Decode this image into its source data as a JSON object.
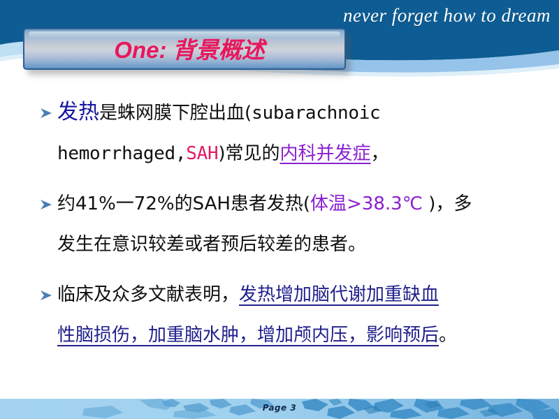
{
  "slide": {
    "tagline": "never forget   how to dream",
    "title_lead": "One:",
    "title_cjk": "背景概述",
    "bullet_marker_icon": "arrowhead-bullet-icon"
  },
  "bullets": [
    {
      "id": "bullet-fever-definition",
      "segments": [
        {
          "text": "发热",
          "style": "blue-large-cjk"
        },
        {
          "text": "是蛛网膜下腔出血(",
          "style": "black-cjk"
        },
        {
          "text": "subarachnoic",
          "style": "black-mono"
        },
        {
          "text": "hemorrhaged,",
          "style": "black-mono"
        },
        {
          "text": "SAH",
          "style": "crimson-mono"
        },
        {
          "text": ")常见的",
          "style": "black-cjk"
        },
        {
          "text": "内科并发症",
          "style": "purple-underline-cjk"
        },
        {
          "text": "，",
          "style": "black-cjk"
        }
      ]
    },
    {
      "id": "bullet-fever-incidence",
      "segments": [
        {
          "text": "约41%一72%的SAH患者发热(",
          "style": "black-cjk"
        },
        {
          "text": "体温>38.3℃",
          "style": "purple-cjk"
        },
        {
          "text": " )，多",
          "style": "black-cjk"
        },
        {
          "text": "发生在意识较差或者预后较差的患者。",
          "style": "black-cjk"
        }
      ]
    },
    {
      "id": "bullet-clinical-evidence",
      "segments": [
        {
          "text": "临床及众多文献表明，",
          "style": "black-cjk"
        },
        {
          "text": "发热增加脑代谢加重缺血",
          "style": "navy-underline-cjk"
        },
        {
          "text": "性脑损伤，加重脑水肿，增加颅内压，影响预后",
          "style": "navy-underline-cjk"
        },
        {
          "text": "。",
          "style": "black-cjk"
        }
      ]
    }
  ],
  "bullet_lines": {
    "b1_l1_a": "发热",
    "b1_l1_b": "是蛛网膜下腔出血(",
    "b1_l1_c": "subarachnoic",
    "b1_l2_a": "hemorrhaged,",
    "b1_l2_b": "SAH",
    "b1_l2_c": ")常见的",
    "b1_l2_d": "内科并发症",
    "b1_l2_e": "，",
    "b2_l1_a": "约41%一72%的SAH患者发热(",
    "b2_l1_b": "体温>38.3℃",
    "b2_l1_c": " )，多",
    "b2_l2_a": "发生在意识较差或者预后较差的患者。",
    "b3_l1_a": "临床及众多文献表明，",
    "b3_l1_b": "发热增加脑代谢加重缺血",
    "b3_l2_a": "性脑损伤，加重脑水肿，增加颅内压，影响预后",
    "b3_l2_b": "。"
  },
  "footer": {
    "page_label": "Page  3"
  },
  "colors": {
    "header_dark_blue": "#0d5c93",
    "header_light_wave": "#8fc0e8",
    "title_accent": "#e8175d",
    "bullet_blue": "#1414a0",
    "crimson": "#e31b63",
    "purple": "#8a1fd0",
    "navy_underline": "#20208c",
    "footer_blue": "#a3d3ef"
  }
}
